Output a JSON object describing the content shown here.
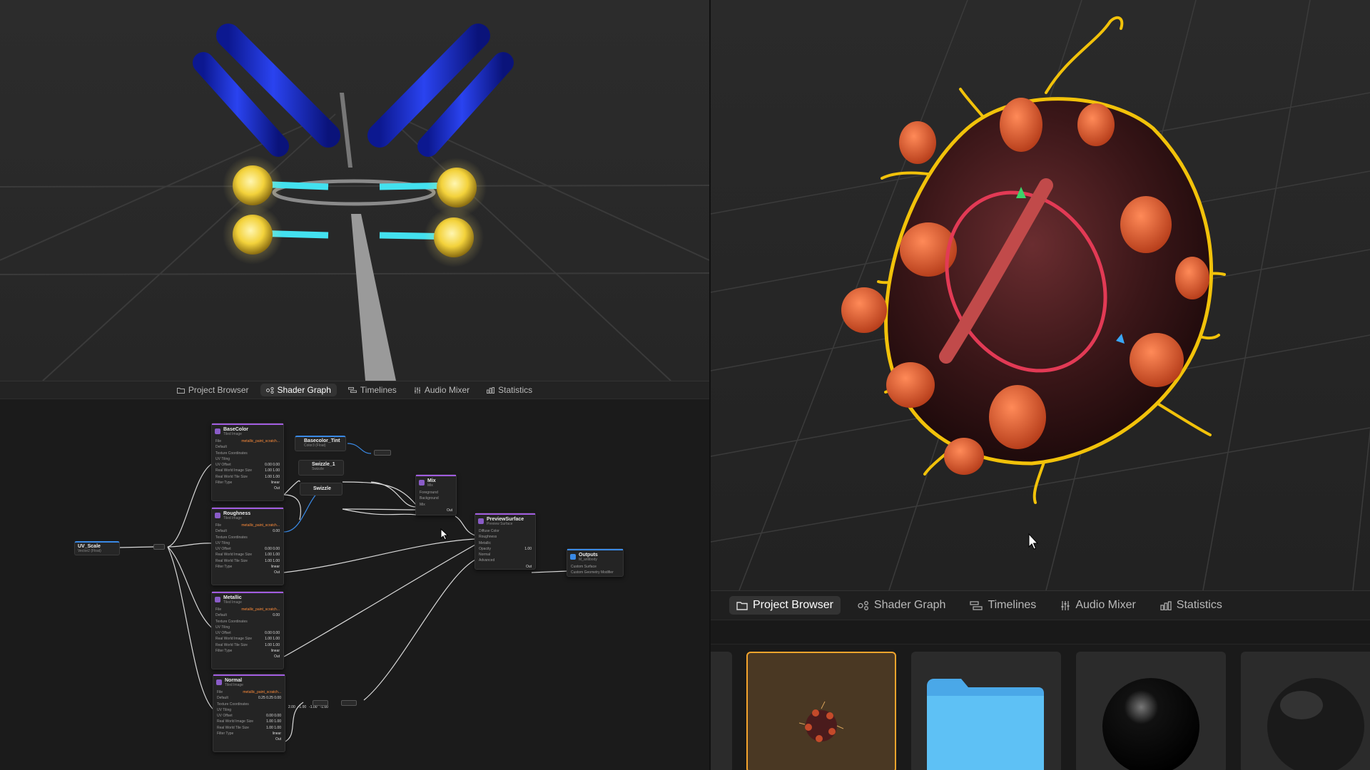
{
  "left_panel": {
    "tabs": [
      {
        "label": "Project Browser",
        "icon": "folder-icon",
        "active": false
      },
      {
        "label": "Shader Graph",
        "icon": "shader-graph-icon",
        "active": true
      },
      {
        "label": "Timelines",
        "icon": "timelines-icon",
        "active": false
      },
      {
        "label": "Audio Mixer",
        "icon": "audio-mixer-icon",
        "active": false
      },
      {
        "label": "Statistics",
        "icon": "statistics-icon",
        "active": false
      }
    ]
  },
  "right_panel": {
    "tabs": [
      {
        "label": "Project Browser",
        "icon": "folder-icon",
        "active": true
      },
      {
        "label": "Shader Graph",
        "icon": "shader-graph-icon",
        "active": false
      },
      {
        "label": "Timelines",
        "icon": "timelines-icon",
        "active": false
      },
      {
        "label": "Audio Mixer",
        "icon": "audio-mixer-icon",
        "active": false
      },
      {
        "label": "Statistics",
        "icon": "statistics-icon",
        "active": false
      }
    ]
  },
  "shader_graph": {
    "uv_scale": {
      "title": "UV_Scale",
      "subtitle": "Vector2 (Float)"
    },
    "basecolor": {
      "title": "BaseColor",
      "subtitle": "Tiled Image",
      "file": "metallic_paint_scratch...",
      "rows": [
        {
          "label": "File",
          "value": "metallic_paint_scratch..."
        },
        {
          "label": "Default",
          "value": ""
        },
        {
          "label": "Texture Coordinates",
          "value": ""
        },
        {
          "label": "UV Tiling",
          "value": ""
        },
        {
          "label": "UV Offset",
          "value": "0.00   0.00"
        },
        {
          "label": "Real World Image Size",
          "value": "1.00   1.00"
        },
        {
          "label": "Real World Tile Size",
          "value": "1.00   1.00"
        },
        {
          "label": "Filter Type",
          "value": "linear"
        },
        {
          "label": "",
          "value": "Out"
        }
      ]
    },
    "roughness": {
      "title": "Roughness",
      "subtitle": "Tiled Image",
      "rows": [
        {
          "label": "File",
          "value": "metallic_paint_scratch..."
        },
        {
          "label": "Default",
          "value": "0.00"
        },
        {
          "label": "Texture Coordinates",
          "value": ""
        },
        {
          "label": "UV Tiling",
          "value": ""
        },
        {
          "label": "UV Offset",
          "value": "0.00   0.00"
        },
        {
          "label": "Real World Image Size",
          "value": "1.00   1.00"
        },
        {
          "label": "Real World Tile Size",
          "value": "1.00   1.00"
        },
        {
          "label": "Filter Type",
          "value": "linear"
        },
        {
          "label": "",
          "value": "Out"
        }
      ]
    },
    "metallic": {
      "title": "Metallic",
      "subtitle": "Tiled Image",
      "rows": [
        {
          "label": "File",
          "value": "metallic_paint_scratch..."
        },
        {
          "label": "Default",
          "value": "0.00"
        },
        {
          "label": "Texture Coordinates",
          "value": ""
        },
        {
          "label": "UV Tiling",
          "value": ""
        },
        {
          "label": "UV Offset",
          "value": "0.00   0.00"
        },
        {
          "label": "Real World Image Size",
          "value": "1.00   1.00"
        },
        {
          "label": "Real World Tile Size",
          "value": "1.00   1.00"
        },
        {
          "label": "Filter Type",
          "value": "linear"
        },
        {
          "label": "",
          "value": "Out"
        }
      ]
    },
    "normal": {
      "title": "Normal",
      "subtitle": "Tiled Image",
      "rows": [
        {
          "label": "File",
          "value": "metallic_paint_scratch..."
        },
        {
          "label": "Default",
          "value": "0.25   0.25   0.00"
        },
        {
          "label": "Texture Coordinates",
          "value": ""
        },
        {
          "label": "UV Tiling",
          "value": ""
        },
        {
          "label": "UV Offset",
          "value": "0.00   0.00"
        },
        {
          "label": "Real World Image Size",
          "value": "1.00   1.00"
        },
        {
          "label": "Real World Tile Size",
          "value": "1.00   1.00"
        },
        {
          "label": "Filter Type",
          "value": "linear"
        },
        {
          "label": "",
          "value": "Out"
        }
      ]
    },
    "basecolor_tint": {
      "title": "Basecolor_Tint",
      "subtitle": "Color3 (Float)"
    },
    "swizzle_1": {
      "title": "Swizzle_1",
      "subtitle": "Swizzle"
    },
    "swizzle": {
      "title": "Swizzle"
    },
    "mix": {
      "title": "Mix",
      "subtitle": "Mix",
      "rows": [
        {
          "label": "Foreground",
          "value": ""
        },
        {
          "label": "Background",
          "value": ""
        },
        {
          "label": "Mix",
          "value": ""
        },
        {
          "label": "",
          "value": "Out"
        }
      ]
    },
    "preview_surface": {
      "title": "PreviewSurface",
      "subtitle": "Preview Surface",
      "rows": [
        {
          "label": "Diffuse Color",
          "value": ""
        },
        {
          "label": "Roughness",
          "value": ""
        },
        {
          "label": "Metallic",
          "value": ""
        },
        {
          "label": "Opacity",
          "value": "1.00"
        },
        {
          "label": "Normal",
          "value": ""
        },
        {
          "label": "Advanced",
          "value": ""
        },
        {
          "label": "",
          "value": "Out"
        }
      ]
    },
    "outputs": {
      "title": "Outputs",
      "subtitle": "M_antibody",
      "rows": [
        {
          "label": "Custom Surface",
          "value": ""
        },
        {
          "label": "Custom Geometry Modifier",
          "value": ""
        }
      ]
    },
    "normal_chain": {
      "v1": "2.00",
      "v2": "-1.00",
      "v3": "-1.00",
      "v4": "-1.00"
    }
  },
  "assets": [
    {
      "type": "model-thumbnail",
      "icon": "virus-model-icon",
      "selected": true
    },
    {
      "type": "folder",
      "icon": "folder-icon",
      "selected": false
    },
    {
      "type": "material",
      "icon": "black-sphere-icon",
      "selected": false
    },
    {
      "type": "material",
      "icon": "black-sphere-icon",
      "selected": false
    }
  ],
  "colors": {
    "accent_selection": "#f4a42c",
    "antibody_blue": "#1a2fd6",
    "antibody_gold": "#f3d23b",
    "virus_outline": "#f2c20a",
    "node_purple": "#a15ce0",
    "node_blue": "#3a8ae6",
    "file_orange": "#ff8c3a",
    "folder_blue": "#5ec1f5"
  }
}
